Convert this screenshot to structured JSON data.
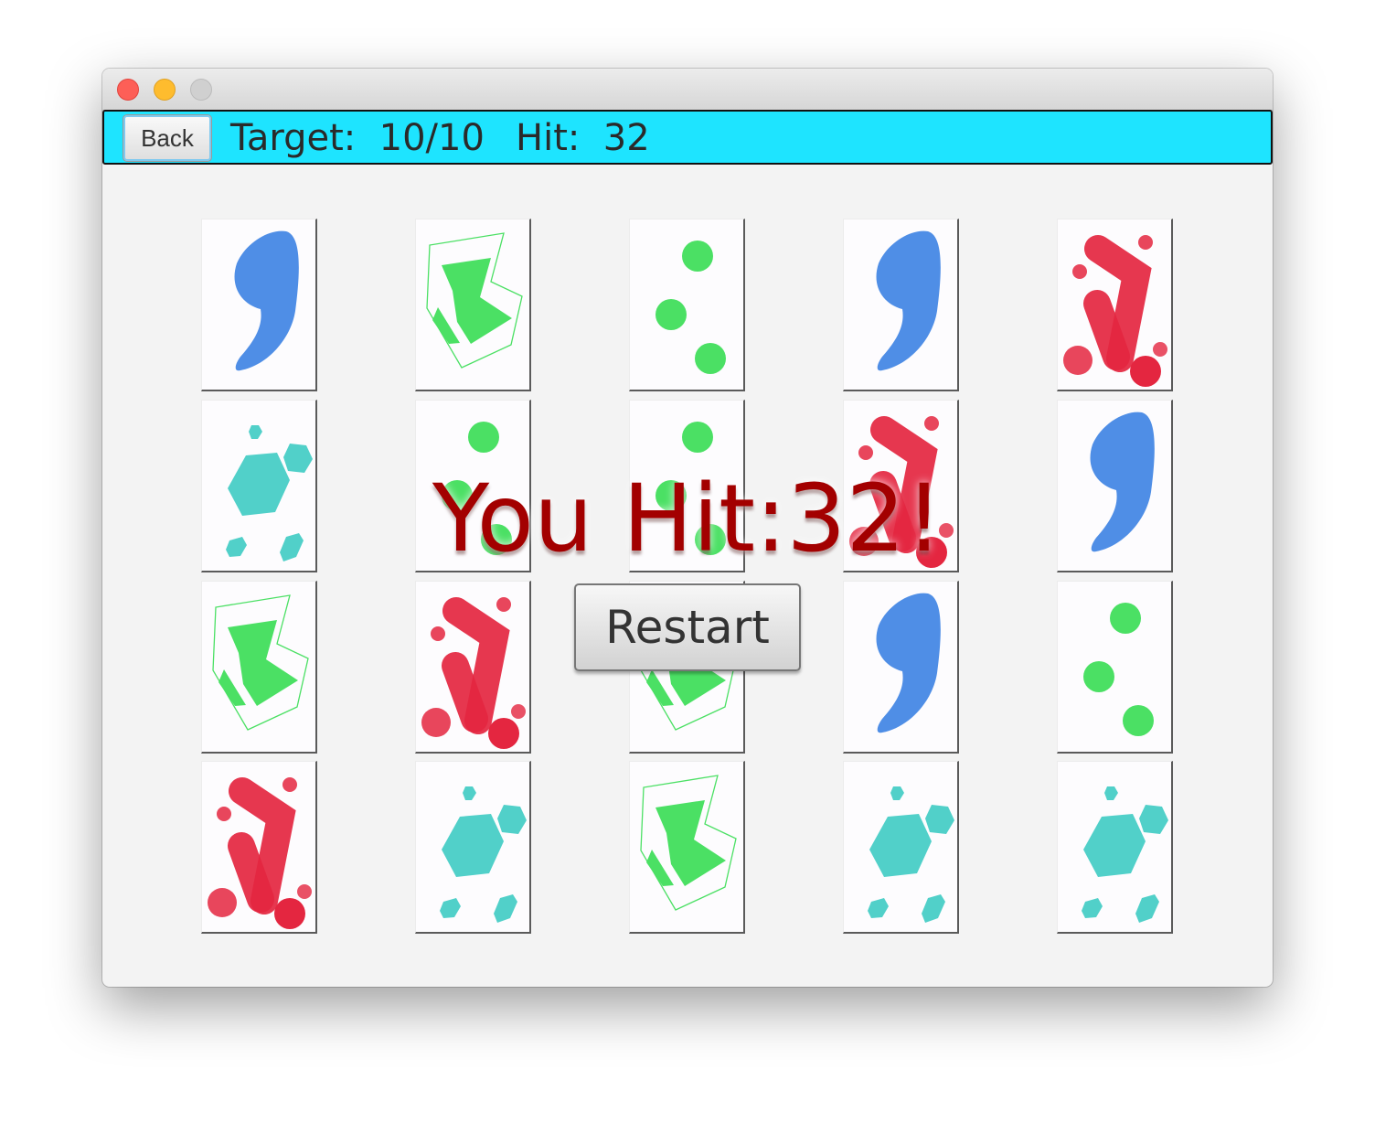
{
  "window": {
    "controls": [
      "close-icon",
      "minimize-icon",
      "maximize-icon"
    ]
  },
  "topbar": {
    "back_label": "Back",
    "target_text": "Target:  10/10",
    "hit_text": "Hit:  32",
    "bar_color": "#1ee4ff"
  },
  "grid": {
    "columns": 5,
    "rows": 4,
    "cards": [
      [
        "blue-comma",
        "green-shield",
        "green-dots",
        "blue-comma",
        "red-check"
      ],
      [
        "teal-hexagons",
        "green-dots",
        "green-dots",
        "red-check",
        "blue-comma"
      ],
      [
        "green-shield",
        "red-check",
        "green-shield",
        "blue-comma",
        "green-dots"
      ],
      [
        "red-check",
        "teal-hexagons",
        "green-shield",
        "teal-hexagons",
        "teal-hexagons"
      ]
    ]
  },
  "colors": {
    "blue": "#4f8ee6",
    "green": "#4be064",
    "red": "#e42640",
    "teal": "#51d0c9",
    "result_text": "#a30000"
  },
  "result": {
    "message": "You Hit:32!",
    "restart_label": "Restart"
  }
}
